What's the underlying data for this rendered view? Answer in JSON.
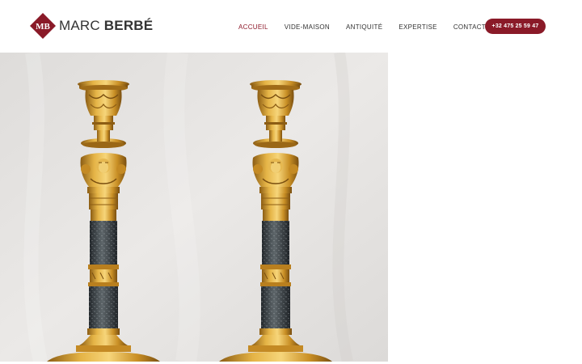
{
  "header": {
    "logo": {
      "monogram": "MB",
      "first_name": "MARC",
      "last_name": "BERBÉ",
      "brand_color": "#8a1a28"
    },
    "nav": {
      "items": [
        {
          "label": "ACCUEIL",
          "active": true
        },
        {
          "label": "VIDE-MAISON",
          "active": false
        },
        {
          "label": "ANTIQUITÉ",
          "active": false
        },
        {
          "label": "EXPERTISE",
          "active": false
        },
        {
          "label": "CONTACT",
          "active": false
        }
      ],
      "active_color": "#8e1a2b"
    },
    "phone_button": {
      "label": "+32 475 25 59 47",
      "color": "#8a1a28"
    }
  },
  "hero": {
    "image": "pair-of-gilt-bronze-candlesticks-photo",
    "background_color": "#e4e2e0",
    "gilt_color": "#d8a333",
    "marble_color": "#3b4146"
  }
}
